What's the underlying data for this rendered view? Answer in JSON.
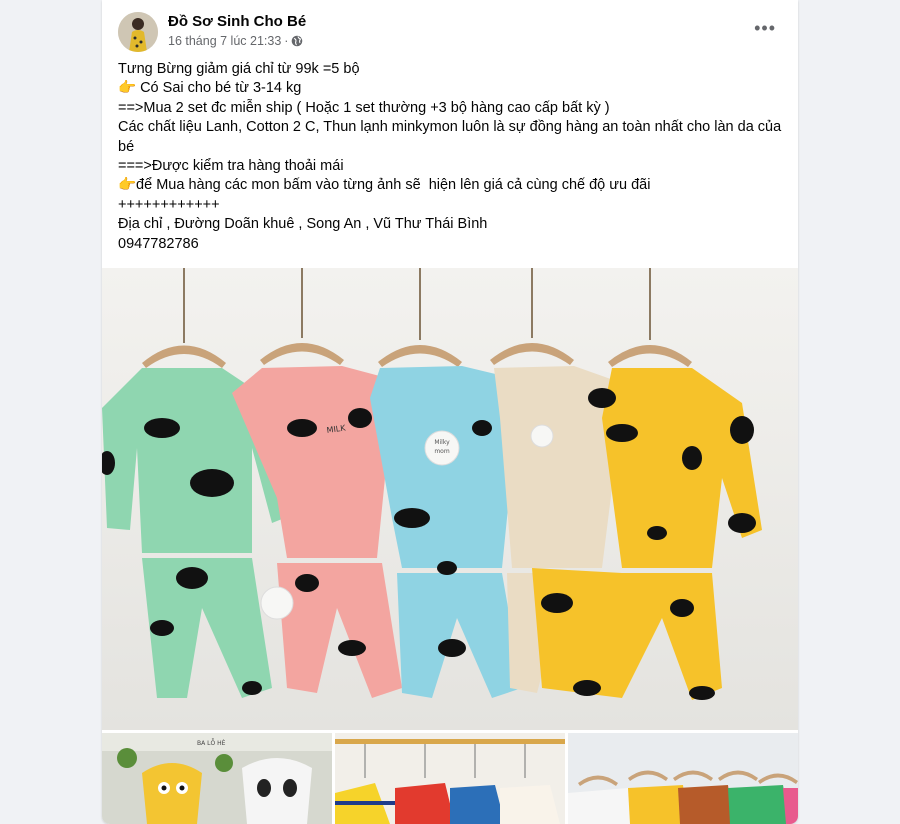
{
  "post": {
    "page_name": "Đồ Sơ Sinh Cho Bé",
    "timestamp": "16 tháng 7 lúc 21:33",
    "separator": "·",
    "more_icon": "more-horizontal-icon",
    "privacy_icon": "globe-icon",
    "lines": [
      "Tưng Bừng giảm giá chỉ từ 99k =5 bộ",
      "👉 Có Sai cho bé từ 3-14 kg",
      "==>Mua 2 set đc miễn ship ( Hoặc 1 set thường +3 bộ hàng cao cấp bất kỳ )",
      "Các chất liệu Lanh, Cotton 2 C, Thun lạnh minkymon luôn là sự đồng hàng an toàn nhất cho làn da của bé",
      "===>Được kiểm tra hàng thoải mái",
      "👉để Mua hàng các mon bấm vào từng ảnh sẽ  hiện lên giá cả cùng chế độ ưu đãi",
      "++++++++++++",
      "Địa chỉ , Đường Doãn khuê , Song An , Vũ Thư Thái Bình",
      "0947782786"
    ]
  },
  "photo": {
    "tag_text_1": "Milky",
    "tag_text_2": "mom",
    "print_text": "MILK"
  },
  "thumbs": {
    "thumb1_label": "BA LỖ HÈ"
  },
  "colors": {
    "green": "#8fd6b0",
    "pink": "#f3a5a0",
    "blue": "#8fd3e3",
    "beige": "#eadcc4",
    "yellow": "#f6c22a"
  }
}
